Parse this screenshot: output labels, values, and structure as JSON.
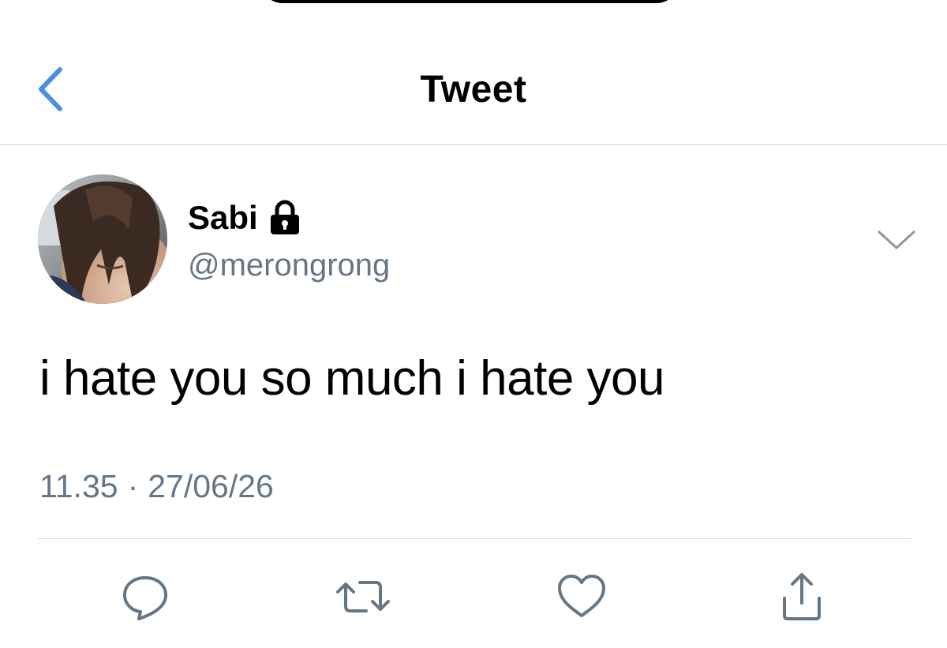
{
  "header": {
    "title": "Tweet",
    "back_icon": "chevron-left-icon",
    "accent_color": "#4a90e2"
  },
  "tweet": {
    "author": {
      "display_name": "Sabi",
      "handle": "@merongrong",
      "protected_icon": "lock-icon",
      "avatar": "avatar-photo"
    },
    "menu_icon": "chevron-down-icon",
    "text": "i hate you so much i hate you",
    "time": "11.35",
    "separator": "·",
    "date": "27/06/26"
  },
  "actions": [
    {
      "name": "reply",
      "icon": "reply-icon"
    },
    {
      "name": "retweet",
      "icon": "retweet-icon"
    },
    {
      "name": "like",
      "icon": "heart-icon"
    },
    {
      "name": "share",
      "icon": "share-icon"
    }
  ],
  "colors": {
    "secondary_text": "#657786",
    "icon_gray": "#657786",
    "divider": "#d6dbdf"
  }
}
